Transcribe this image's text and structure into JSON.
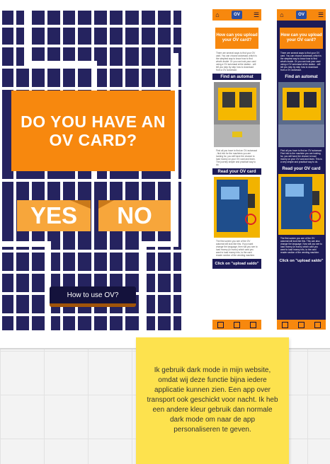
{
  "colors": {
    "navy": "#25235f",
    "orange": "#f7880e",
    "light_orange": "#f7a63b",
    "note": "#fde24e"
  },
  "card": {
    "question": "DO YOU HAVE AN OV CARD?",
    "yes_label": "YES",
    "no_label": "NO",
    "how_button": "How to use OV?"
  },
  "phone_light": {
    "logo": "OV",
    "title": "How can you upload your OV card?",
    "intro": "There are several ways to find your OV card. You can choose automaat, which is the simplest way to know how to find what's inside. Or you can look your card using a OV automaat at the station - will tell you step by step how to download from a OV automaat.",
    "section1": "Find an automat",
    "text1": "Find all you have to find an OV automaat - find info for the machines you are looking for, you will have the chance to load money on your OV card and learn. The journey simple and practical way to do.",
    "section2": "Read your OV card",
    "text2": "The first screen you see of the OV automat will look like this. If you want change the language, then will you see to load money (in euros) which card you want to load money into, to the card reader section of the vending machine.",
    "section3": "Click on \"upload saldo\""
  },
  "phone_dark": {
    "logo": "OV",
    "title": "How can you upload your OV card?",
    "intro": "There are several ways to find your OV card. You can choose automaat, which is the simplest way to know how to find what's inside. Or you can look your card using a OV automaat at the station - will tell you step by step how to download from a OV automaat.",
    "section1": "Find an automat",
    "text1": "Find all you have to find an OV automaat. Find info to the machine you are looking for, you will have the chance to load money on your OV card and learn. This is a very simple and practical way to do.",
    "section2": "Read your OV card",
    "text2": "The first screen you see of the OV automat will look like this. This can also change the language. Now will you see to load money (in euros) which card you want to load money into, to the card reader section of the vending machine.",
    "section3": "Click on \"upload saldo\""
  },
  "note": {
    "text": "Ik gebruik dark mode in mijn website, omdat wij deze functie bijna iedere applicatie kunnen zien. Een app over transport ook geschickt voor nacht. Ik heb een andere kleur gebruik dan normale dark mode om naar de app personaliseren te geven."
  }
}
